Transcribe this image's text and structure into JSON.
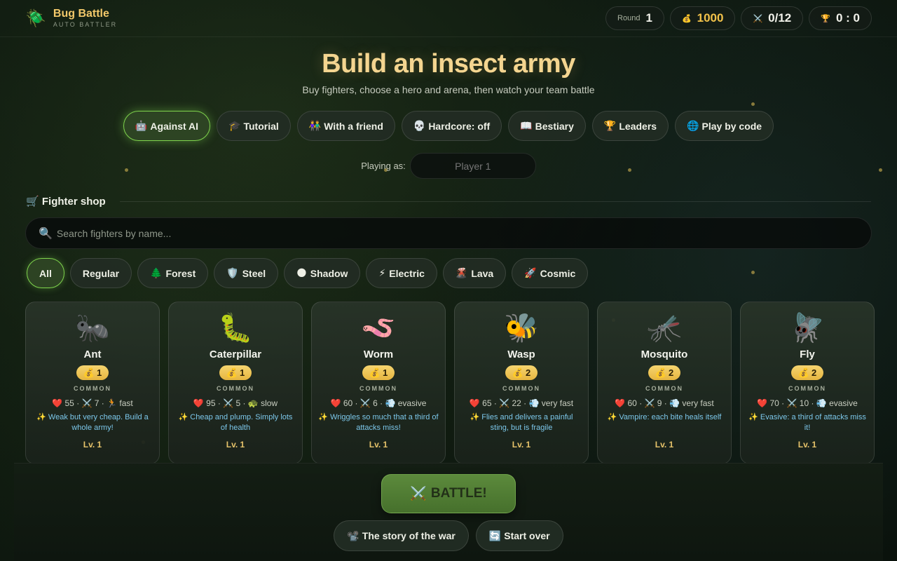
{
  "brand": {
    "icon": "🪲",
    "title": "Bug Battle",
    "subtitle": "AUTO BATTLER"
  },
  "stats": {
    "round_label": "Round",
    "round_value": "1",
    "coins_icon": "💰",
    "coins": "1000",
    "army_icon": "⚔️",
    "army": "0/12",
    "score_icon": "🏆",
    "score": "0 : 0"
  },
  "hero": {
    "title": "Build an insect army",
    "subtitle": "Buy fighters, choose a hero and arena, then watch your team battle"
  },
  "modes": [
    {
      "icon": "🤖",
      "label": "Against AI",
      "active": true
    },
    {
      "icon": "🎓",
      "label": "Tutorial"
    },
    {
      "icon": "👫",
      "label": "With a friend"
    },
    {
      "icon": "💀",
      "label": "Hardcore: off"
    },
    {
      "icon": "📖",
      "label": "Bestiary"
    },
    {
      "icon": "🏆",
      "label": "Leaders"
    },
    {
      "icon": "🌐",
      "label": "Play by code"
    }
  ],
  "player": {
    "label": "Playing as:",
    "placeholder": "Player 1"
  },
  "shop": {
    "icon": "🛒",
    "title": "Fighter shop",
    "search_icon": "🔍",
    "search_placeholder": "Search fighters by name..."
  },
  "filters": [
    {
      "icon": "",
      "label": "All",
      "active": true
    },
    {
      "icon": "",
      "label": "Regular"
    },
    {
      "icon": "🌲",
      "label": "Forest"
    },
    {
      "icon": "🛡️",
      "label": "Steel"
    },
    {
      "icon": "🌑",
      "label": "Shadow"
    },
    {
      "icon": "⚡",
      "label": "Electric"
    },
    {
      "icon": "🌋",
      "label": "Lava"
    },
    {
      "icon": "🚀",
      "label": "Cosmic"
    }
  ],
  "fighters": [
    {
      "icon": "🐜",
      "name": "Ant",
      "cost": "1",
      "rarity": "COMMON",
      "stats": "❤️ 55 · ⚔️ 7 · 🏃 fast",
      "desc": "✨ Weak but very cheap. Build a whole army!",
      "level": "Lv. 1"
    },
    {
      "icon": "🐛",
      "name": "Caterpillar",
      "cost": "1",
      "rarity": "COMMON",
      "stats": "❤️ 95 · ⚔️ 5 · 🐢 slow",
      "desc": "✨ Cheap and plump. Simply lots of health",
      "level": "Lv. 1"
    },
    {
      "icon": "🪱",
      "name": "Worm",
      "cost": "1",
      "rarity": "COMMON",
      "stats": "❤️ 60 · ⚔️ 6 · 💨 evasive",
      "desc": "✨ Wriggles so much that a third of attacks miss!",
      "level": "Lv. 1"
    },
    {
      "icon": "🐝",
      "name": "Wasp",
      "cost": "2",
      "rarity": "COMMON",
      "stats": "❤️ 65 · ⚔️ 22 · 💨 very fast",
      "desc": "✨ Flies and delivers a painful sting, but is fragile",
      "level": "Lv. 1"
    },
    {
      "icon": "🦟",
      "name": "Mosquito",
      "cost": "2",
      "rarity": "COMMON",
      "stats": "❤️ 60 · ⚔️ 9 · 💨 very fast",
      "desc": "✨ Vampire: each bite heals itself",
      "level": "Lv. 1"
    },
    {
      "icon": "🪰",
      "name": "Fly",
      "cost": "2",
      "rarity": "COMMON",
      "stats": "❤️ 70 · ⚔️ 10 · 💨 evasive",
      "desc": "✨ Evasive: a third of attacks miss it!",
      "level": "Lv. 1"
    }
  ],
  "actions": {
    "battle_icon": "⚔️",
    "battle": "BATTLE!",
    "story_icon": "📽️",
    "story": "The story of the war",
    "restart_icon": "🔄",
    "restart": "Start over"
  },
  "colors": {
    "accent": "#7fd44d",
    "gold": "#f2c24a",
    "title": "#f4d590",
    "desc": "#7cc7ea"
  }
}
